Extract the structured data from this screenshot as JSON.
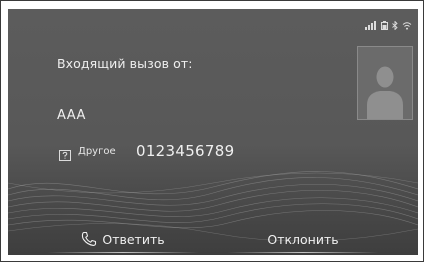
{
  "status_bar": {
    "icons": [
      "signal-strength-icon",
      "battery-icon",
      "bluetooth-icon",
      "wifi-icon"
    ]
  },
  "incoming_call": {
    "title": "Входящий вызов от:",
    "caller_name": "AAA",
    "phone_type_icon": "phone-type-other-icon",
    "phone_type": "Другое",
    "phone_number": "0123456789",
    "avatar_icon": "contact-silhouette-icon"
  },
  "actions": {
    "answer_label": "Ответить",
    "answer_icon": "phone-handset-icon",
    "decline_label": "Отклонить"
  }
}
